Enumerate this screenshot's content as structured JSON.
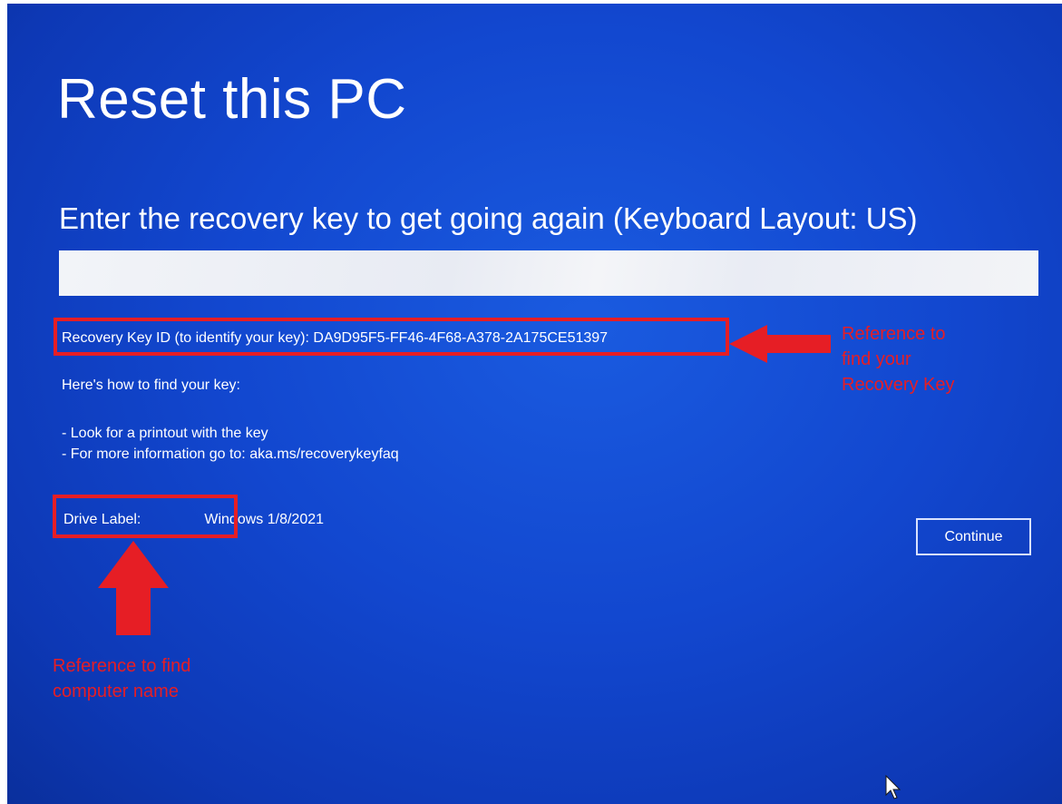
{
  "screen": {
    "title": "Reset this PC",
    "prompt": "Enter the recovery key to get going again (Keyboard Layout: US)",
    "key_input": {
      "value": "",
      "placeholder": ""
    },
    "recovery_key_id_line": "Recovery Key ID (to identify your key): DA9D95F5-FF46-4F68-A378-2A175CE51397",
    "howto_heading": "Here's how to find your key:",
    "bullets": [
      "- Look for a printout with the key",
      "- For more information go to: aka.ms/recoverykeyfaq"
    ],
    "drive_label_caption": "Drive Label:",
    "drive_label_value": "Windows 1/8/2021",
    "continue_label": "Continue"
  },
  "annotations": {
    "key_reference_lines": [
      "Reference to",
      "find your",
      "Recovery Key"
    ],
    "drive_reference_lines": [
      "Reference to find",
      "computer name"
    ],
    "color": "#e61e25"
  },
  "colors": {
    "background_blue": "#1247cf",
    "text": "#ffffff"
  },
  "icons": {
    "cursor": "mouse-pointer-icon",
    "key_arrow": "left-arrow-icon",
    "drive_arrow": "up-arrow-icon"
  }
}
